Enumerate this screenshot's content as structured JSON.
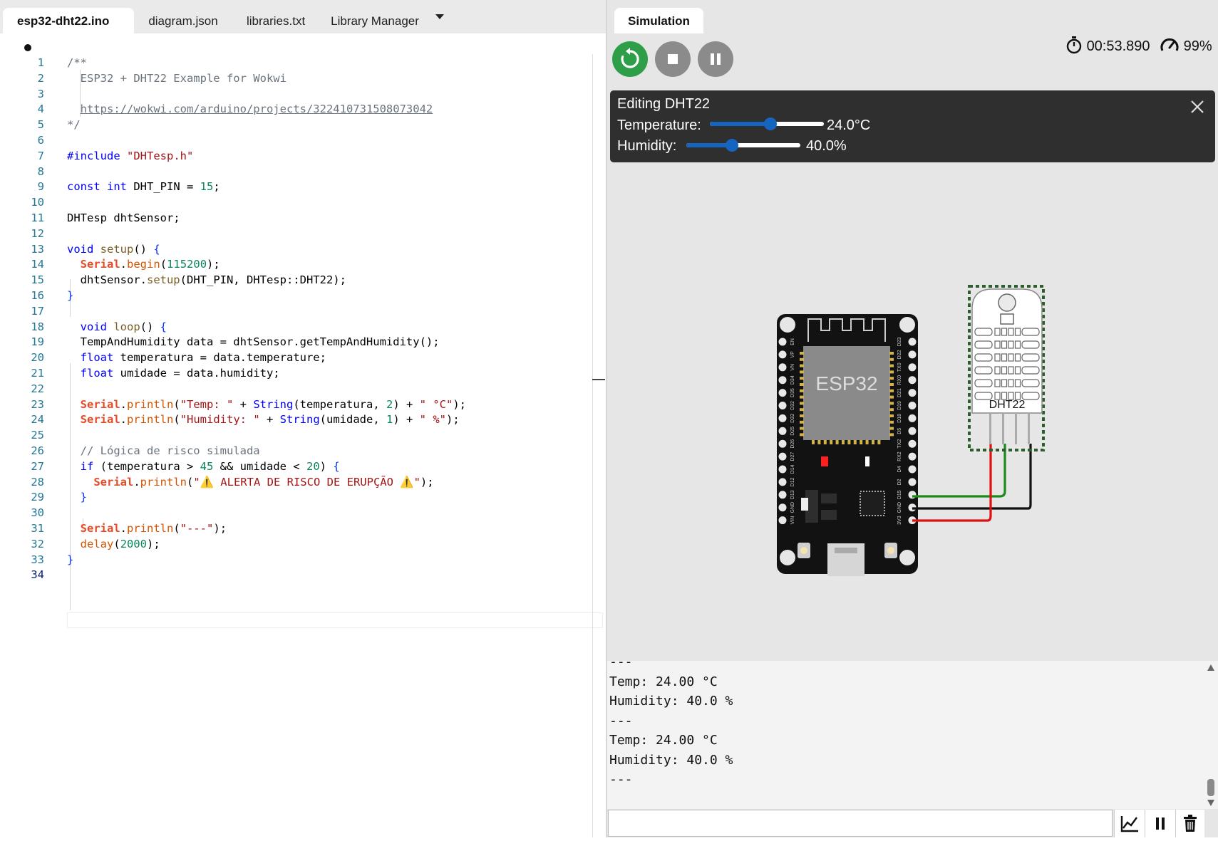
{
  "tabs": [
    {
      "label": "esp32-dht22.ino",
      "active": true,
      "modified": true
    },
    {
      "label": "diagram.json"
    },
    {
      "label": "libraries.txt"
    },
    {
      "label": "Library Manager"
    }
  ],
  "editor": {
    "line_numbers": [
      "1",
      "2",
      "3",
      "4",
      "5",
      "6",
      "7",
      "8",
      "9",
      "10",
      "11",
      "12",
      "13",
      "14",
      "15",
      "16",
      "17",
      "18",
      "19",
      "20",
      "21",
      "22",
      "23",
      "24",
      "25",
      "26",
      "27",
      "28",
      "29",
      "30",
      "31",
      "32",
      "33",
      "34"
    ],
    "current_line": "34",
    "lines": [
      "/**",
      "  ESP32 + DHT22 Example for Wokwi",
      "",
      "  https://wokwi.com/arduino/projects/322410731508073042",
      "*/",
      "",
      "#include \"DHTesp.h\"",
      "",
      "const int DHT_PIN = 15;",
      "",
      "DHTesp dhtSensor;",
      "",
      "void setup() {",
      "  Serial.begin(115200);",
      "  dhtSensor.setup(DHT_PIN, DHTesp::DHT22);",
      "}",
      "",
      "  void loop() {",
      "  TempAndHumidity data = dhtSensor.getTempAndHumidity();",
      "  float temperatura = data.temperature;",
      "  float umidade = data.humidity;",
      "",
      "  Serial.println(\"Temp: \" + String(temperatura, 2) + \" °C\");",
      "  Serial.println(\"Humidity: \" + String(umidade, 1) + \" %\");",
      "",
      "  // Lógica de risco simulada",
      "  if (temperatura > 45 && umidade < 20) {",
      "    Serial.println(\"⚠️ ALERTA DE RISCO DE ERUPÇÃO ⚠️\");",
      "  }",
      "",
      "  Serial.println(\"---\");",
      "  delay(2000);",
      "}",
      ""
    ]
  },
  "simulation": {
    "tab_label": "Simulation",
    "timer": "00:53.890",
    "speed": "99%",
    "controls": [
      "restart-icon",
      "stop-icon",
      "pause-icon"
    ],
    "edit_panel": {
      "title": "Editing DHT22",
      "temperature_label": "Temperature:",
      "temperature_value": "24.0°C",
      "temperature_fraction": 0.53,
      "humidity_label": "Humidity:",
      "humidity_value": "40.0%",
      "humidity_fraction": 0.4
    },
    "board_label": "ESP32",
    "sensor_label": "DHT22",
    "board_pins_left": [
      "EN",
      "VP",
      "VN",
      "D34",
      "D35",
      "D32",
      "D33",
      "D25",
      "D26",
      "D27",
      "D14",
      "D12",
      "D13",
      "GND",
      "VIN"
    ],
    "board_pins_right": [
      "D23",
      "D22",
      "TX0",
      "RX0",
      "D21",
      "D19",
      "D18",
      "D5",
      "TX2",
      "RX2",
      "D4",
      "D2",
      "D15",
      "GND",
      "3V3"
    ],
    "wire_colors": {
      "data": "#1a8a1a",
      "gnd": "#111111",
      "vcc": "#e01010"
    }
  },
  "serial": {
    "lines": [
      "---",
      "Temp: 24.00 °C",
      "Humidity: 40.0 %",
      "---",
      "Temp: 24.00 °C",
      "Humidity: 40.0 %",
      "---"
    ]
  },
  "bottom_buttons": [
    "chart-icon",
    "pause-icon",
    "trash-icon"
  ]
}
